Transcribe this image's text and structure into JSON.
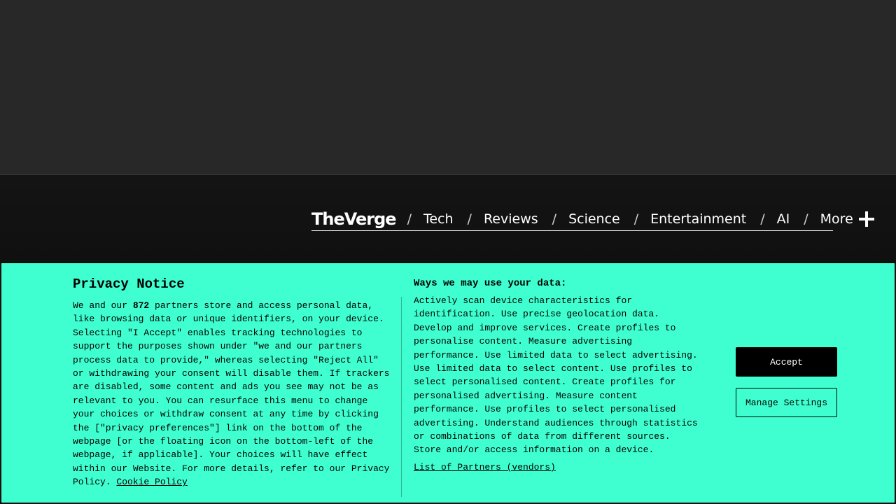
{
  "header": {
    "logo": "TheVerge",
    "separator": "/",
    "nav": [
      "Tech",
      "Reviews",
      "Science",
      "Entertainment",
      "AI"
    ],
    "more_label": "More"
  },
  "privacy": {
    "title": "Privacy Notice",
    "intro_before": "We and our ",
    "partner_count": "872",
    "intro_after": " partners store and access personal data,\nlike browsing data or unique identifiers, on your device.\nSelecting \"I Accept\" enables tracking technologies to\nsupport the purposes shown under \"we and our partners\nprocess data to provide,\" whereas selecting \"Reject All\"\nor withdrawing your consent will disable them. If trackers\nare disabled, some content and ads you see may not be as\nrelevant to you. You can resurface this menu to change\nyour choices or withdraw consent at any time by clicking\nthe [\"privacy preferences\"] link on the bottom of the\nwebpage [or the floating icon on the bottom-left of the\nwebpage, if applicable]. Your choices will have effect\nwithin our Website. For more details, refer to our Privacy\nPolicy. ",
    "cookie_policy": "Cookie Policy",
    "ways_title": "Ways we may use your data:",
    "ways_text": "Actively scan device characteristics for\nidentification. Use precise geolocation data.\nDevelop and improve services. Create profiles to\npersonalise content. Measure advertising\nperformance. Use limited data to select advertising.\nUse limited data to select content. Use profiles to\nselect personalised content. Create profiles for\npersonalised advertising. Measure content\nperformance. Use profiles to select personalised\nadvertising. Understand audiences through statistics\nor combinations of data from different sources.\nStore and/or access information on a device.",
    "partners_link": "List of Partners (vendors)",
    "accept_label": "Accept",
    "manage_label": "Manage Settings"
  },
  "colors": {
    "banner_bg": "#3fffd0",
    "header_bg": "#111111",
    "ad_bg": "#282828"
  }
}
